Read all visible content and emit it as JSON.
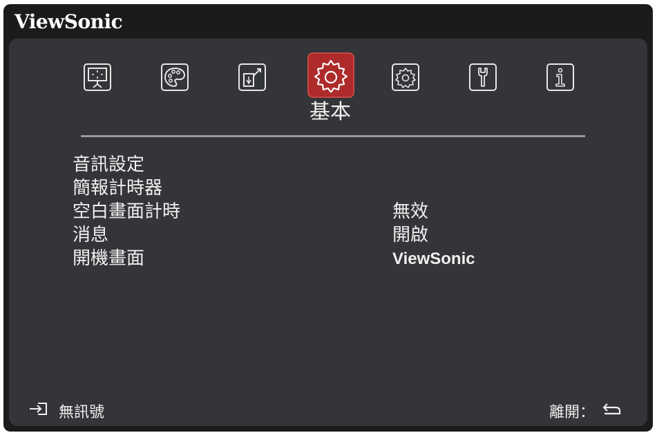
{
  "brand": "ViewSonic",
  "tabs": [
    {
      "icon": "display-icon"
    },
    {
      "icon": "palette-icon"
    },
    {
      "icon": "source-icon"
    },
    {
      "icon": "basic-gear-icon",
      "label": "基本",
      "active": true
    },
    {
      "icon": "advanced-gear-icon"
    },
    {
      "icon": "wrench-icon"
    },
    {
      "icon": "info-icon"
    }
  ],
  "menu": [
    {
      "label": "音訊設定",
      "value": ""
    },
    {
      "label": "簡報計時器",
      "value": ""
    },
    {
      "label": "空白畫面計時",
      "value": "無效"
    },
    {
      "label": "消息",
      "value": "開啟"
    },
    {
      "label": "開機畫面",
      "value": "ViewSonic"
    }
  ],
  "footer": {
    "source_icon": "input-icon",
    "source_status": "無訊號",
    "exit_label": "離開：",
    "exit_icon": "return-icon"
  },
  "colors": {
    "background": "#333538",
    "frame": "#1b1b1b",
    "active_tab": "#ad2b2b",
    "text": "#f0f0f0"
  }
}
